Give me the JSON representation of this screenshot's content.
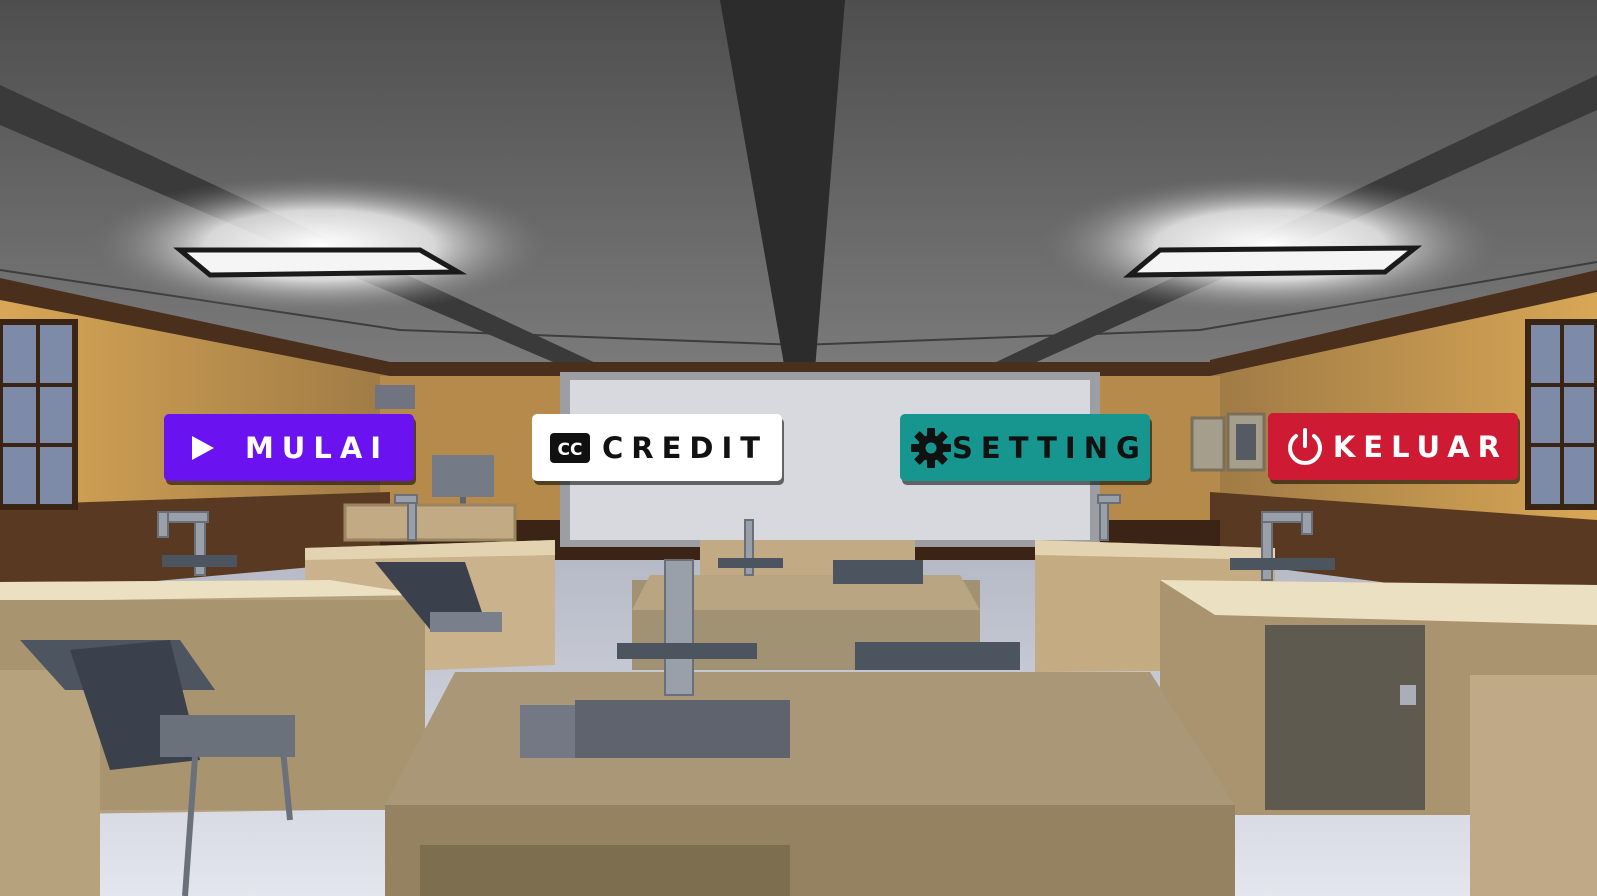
{
  "menu": {
    "mulai": {
      "label": "MULAI",
      "icon": "play-icon",
      "color": "#6a12f0"
    },
    "credit": {
      "label": "CREDIT",
      "icon": "cc-icon",
      "icon_text": "CC",
      "color": "#ffffff"
    },
    "setting": {
      "label": "SETTING",
      "icon": "gear-icon",
      "color": "#17958f"
    },
    "keluar": {
      "label": "KELUAR",
      "icon": "power-icon",
      "color": "#cf1a33"
    }
  },
  "scene": {
    "description_name": "classroom-lab-background",
    "ceiling_color": "#5c5c5c",
    "wall_color": "#c89a52",
    "floor_color": "#c9ccd4",
    "desk_color": "#b9a582"
  }
}
